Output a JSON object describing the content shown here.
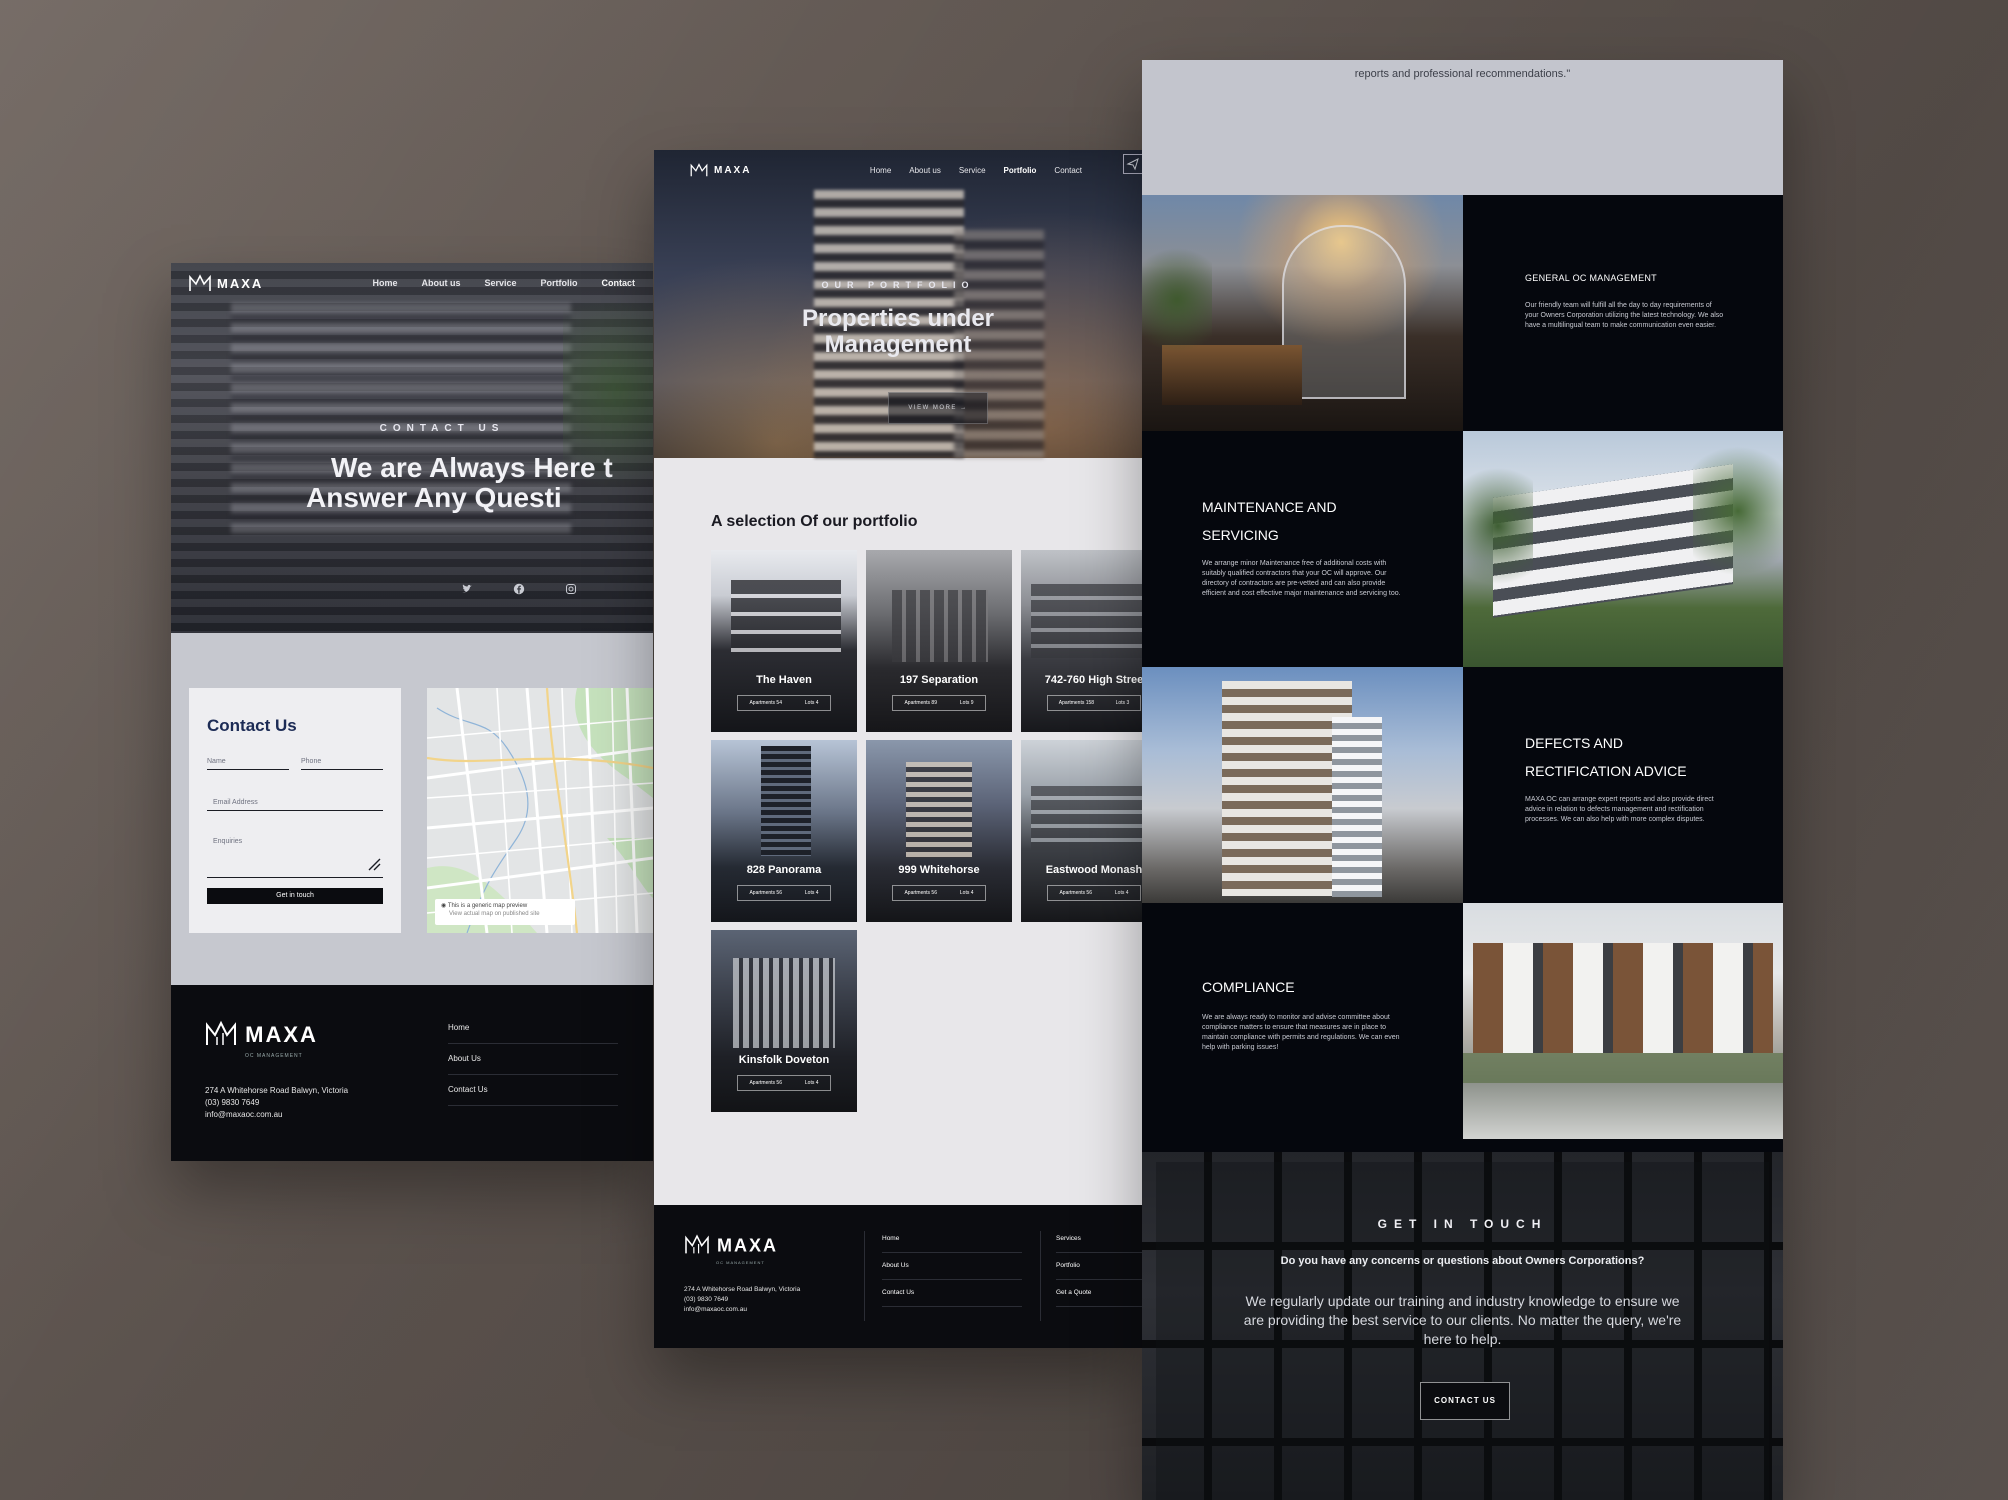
{
  "brand": {
    "name": "MAXA",
    "sub": "OC MANAGEMENT"
  },
  "left_page": {
    "nav": [
      "Home",
      "About us",
      "Service",
      "Portfolio",
      "Contact"
    ],
    "eyebrow": "CONTACT US",
    "title_line1": "We are Always Here t",
    "title_line2": "Answer Any Questi",
    "social": [
      "twitter-icon",
      "facebook-icon",
      "instagram-icon"
    ],
    "contact": {
      "heading": "Contact Us",
      "name_label": "Name",
      "phone_label": "Phone",
      "email_label": "Email Address",
      "enquiries_label": "Enquiries",
      "button": "Get in touch"
    },
    "map_note_line1": "This is a generic map preview",
    "map_note_line2": "View actual map on published site",
    "footer": {
      "address_line1": "274 A Whitehorse Road Balwyn, Victoria",
      "phone": "(03) 9830 7649",
      "email": "info@maxaoc.com.au",
      "links": [
        "Home",
        "About Us",
        "Contact Us"
      ]
    }
  },
  "mid_page": {
    "nav": [
      "Home",
      "About us",
      "Service",
      "Portfolio",
      "Contact"
    ],
    "eyebrow": "OUR PORTFOLIO",
    "title_line1": "Properties under",
    "title_line2": "Management",
    "view_more": "VIEW MORE →",
    "section_title": "A selection Of our portfolio",
    "properties": [
      {
        "name": "The Haven",
        "apartments": "Apartments 54",
        "lots": "Lots 4"
      },
      {
        "name": "197 Separation",
        "apartments": "Apartments 89",
        "lots": "Lots 9"
      },
      {
        "name": "742-760 High Stree",
        "apartments": "Apartments 158",
        "lots": "Lots 3"
      },
      {
        "name": "828 Panorama",
        "apartments": "Apartments 56",
        "lots": "Lots 4"
      },
      {
        "name": "999 Whitehorse",
        "apartments": "Apartments 56",
        "lots": "Lots 4"
      },
      {
        "name": "Eastwood Monash",
        "apartments": "Apartments 56",
        "lots": "Lots 4"
      },
      {
        "name": "Kinsfolk Doveton",
        "apartments": "Apartments 56",
        "lots": "Lots 4"
      }
    ],
    "footer": {
      "address_line1": "274 A Whitehorse Road Balwyn, Victoria",
      "phone": "(03) 9830 7649",
      "email": "info@maxaoc.com.au",
      "col1": [
        "Home",
        "About Us",
        "Contact Us"
      ],
      "col2": [
        "Services",
        "Portfolio",
        "Get a Quote"
      ]
    }
  },
  "right_page": {
    "quote": "reports and professional recommendations.\"",
    "services": [
      {
        "title": "GENERAL OC MANAGEMENT",
        "text": "Our friendly team will fulfill all the day to day requirements of your Owners Corporation utilizing the latest technology. We also have a multilingual team to make communication even easier."
      },
      {
        "title_line1": "MAINTENANCE AND",
        "title_line2": "SERVICING",
        "text": "We arrange minor Maintenance free of additional costs with suitably qualified contractors that your OC will approve. Our directory of contractors are pre-vetted and can also provide efficient and cost effective major maintenance and servicing too."
      },
      {
        "title_line1": "DEFECTS AND",
        "title_line2": "RECTIFICATION ADVICE",
        "text": "MAXA OC can arrange expert reports and also provide direct advice in relation to defects management and rectification processes. We can also help with more complex disputes."
      },
      {
        "title": "COMPLIANCE",
        "text": "We are always ready to monitor and advise committee about compliance matters to ensure that measures are in place to maintain compliance with permits and regulations. We can even help with parking issues!"
      }
    ],
    "get_in_touch": {
      "eyebrow": "GET IN TOUCH",
      "question": "Do you have any concerns or questions about Owners Corporations?",
      "text": "We regularly update our training and industry knowledge to ensure we are providing the best service to our clients. No matter the query, we're here to help.",
      "button": "CONTACT US"
    }
  }
}
